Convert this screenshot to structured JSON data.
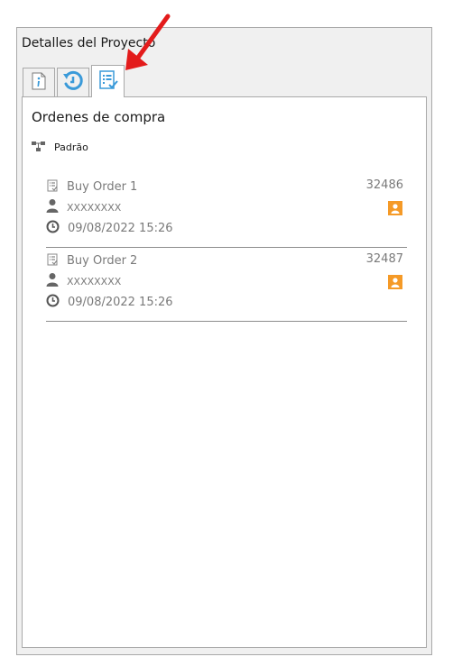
{
  "panel": {
    "title": "Detalles del Proyecto"
  },
  "tabs": [
    {
      "icon": "info-icon"
    },
    {
      "icon": "history-icon"
    },
    {
      "icon": "purchase-orders-icon",
      "active": true
    }
  ],
  "section": {
    "title": "Ordenes de compra"
  },
  "tree": {
    "icon": "tree-nodes-icon",
    "label": "Padrão"
  },
  "orders": [
    {
      "name": "Buy Order  1",
      "id": "32486",
      "user": "XXXXXXXX",
      "datetime": "09/08/2022 15:26"
    },
    {
      "name": "Buy Order  2",
      "id": "32487",
      "user": "XXXXXXXX",
      "datetime": "09/08/2022 15:26"
    }
  ],
  "colors": {
    "accent_orange": "#f59a27",
    "tab_icon_blue": "#3a9ad9",
    "annotation_red": "#e31b1b"
  }
}
